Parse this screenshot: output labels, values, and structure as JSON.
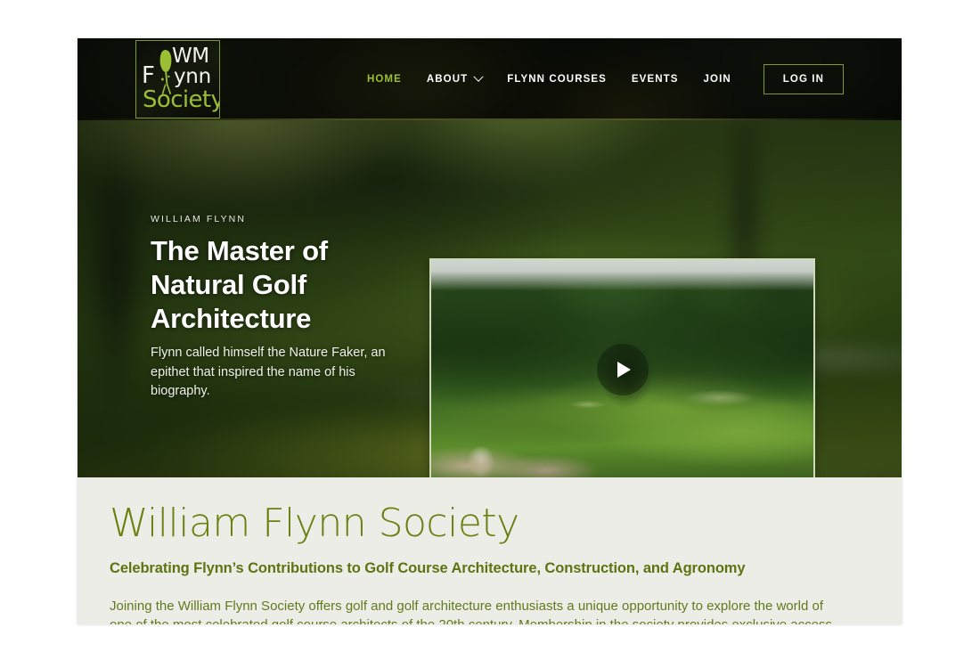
{
  "header": {
    "logo": {
      "line1": "WM",
      "mark_f": "F",
      "line2": "ynn",
      "line3": "Society",
      "icon": "golfer-silhouette-icon"
    },
    "nav": [
      {
        "label": "HOME",
        "active": true,
        "has_dropdown": false
      },
      {
        "label": "ABOUT",
        "active": false,
        "has_dropdown": true
      },
      {
        "label": "FLYNN COURSES",
        "active": false,
        "has_dropdown": false
      },
      {
        "label": "EVENTS",
        "active": false,
        "has_dropdown": false
      },
      {
        "label": "JOIN",
        "active": false,
        "has_dropdown": false
      }
    ],
    "login_label": "LOG IN",
    "active_color": "#9dbf33",
    "border_color": "#7c9a2e"
  },
  "hero": {
    "eyebrow": "WILLIAM FLYNN",
    "title": "The Master of Natural Golf Architecture",
    "subtitle": "Flynn called himself the Nature Faker, an epithet that inspired the name of his biography.",
    "video": {
      "play_icon": "play-triangle-icon",
      "alt": "golf-course-video-thumbnail"
    }
  },
  "main": {
    "title": "William Flynn Society",
    "subtitle": "Celebrating Flynn’s Contributions to Golf Course Architecture, Construction, and Agronomy",
    "body": "Joining the William Flynn Society offers golf and golf architecture enthusiasts a unique opportunity to explore the world of one of the most celebrated golf course architects of the 20th century. Membership in the society provides exclusive access to the"
  },
  "colors": {
    "accent_green": "#9dbf33",
    "olive": "#6b8012",
    "body_text": "#637a1d",
    "section_bg": "#ecedE7",
    "header_bg": "#0d0f09"
  }
}
